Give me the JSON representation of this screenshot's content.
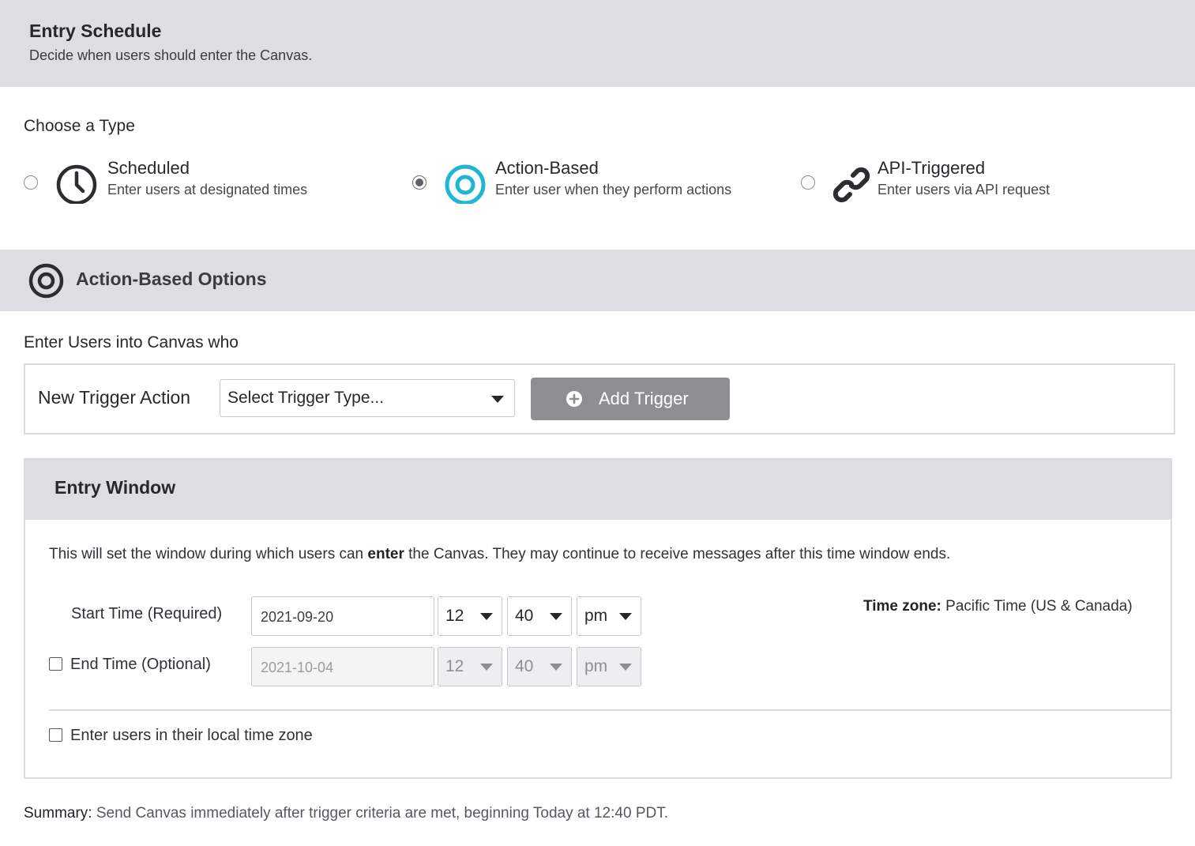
{
  "header": {
    "title": "Entry Schedule",
    "subtitle": "Decide when users should enter the Canvas."
  },
  "type_section": {
    "label": "Choose a Type",
    "options": [
      {
        "title": "Scheduled",
        "description": "Enter users at designated times",
        "icon": "clock-icon",
        "selected": false
      },
      {
        "title": "Action-Based",
        "description": "Enter user when they perform actions",
        "icon": "target-icon",
        "selected": true
      },
      {
        "title": "API-Triggered",
        "description": "Enter users via API request",
        "icon": "link-icon",
        "selected": false
      }
    ]
  },
  "action_based": {
    "title": "Action-Based Options",
    "icon": "target-icon",
    "enter_users_label": "Enter Users into Canvas who",
    "trigger": {
      "label": "New Trigger Action",
      "select_value": "Select Trigger Type...",
      "add_button": "Add Trigger",
      "add_icon": "plus-circle-icon"
    }
  },
  "entry_window": {
    "title": "Entry Window",
    "desc_before": "This will set the window during which users can ",
    "desc_bold": "enter",
    "desc_after": " the Canvas. They may continue to receive messages after this time window ends.",
    "start": {
      "label": "Start Time (Required)",
      "date": "2021-09-20",
      "hour": "12",
      "minute": "40",
      "ampm": "pm"
    },
    "end": {
      "label": "End Time (Optional)",
      "checked": false,
      "date": "2021-10-04",
      "hour": "12",
      "minute": "40",
      "ampm": "pm"
    },
    "timezone_label": "Time zone:",
    "timezone_value": " Pacific Time (US & Canada)",
    "local_tz_label": "Enter users in their local time zone",
    "local_tz_checked": false
  },
  "summary": {
    "label": "Summary:",
    "text": " Send Canvas immediately after trigger criteria are met, beginning Today at 12:40 PDT."
  },
  "colors": {
    "accent": "#1fb6d4",
    "band": "#dddde2",
    "button": "#8e8f93"
  }
}
